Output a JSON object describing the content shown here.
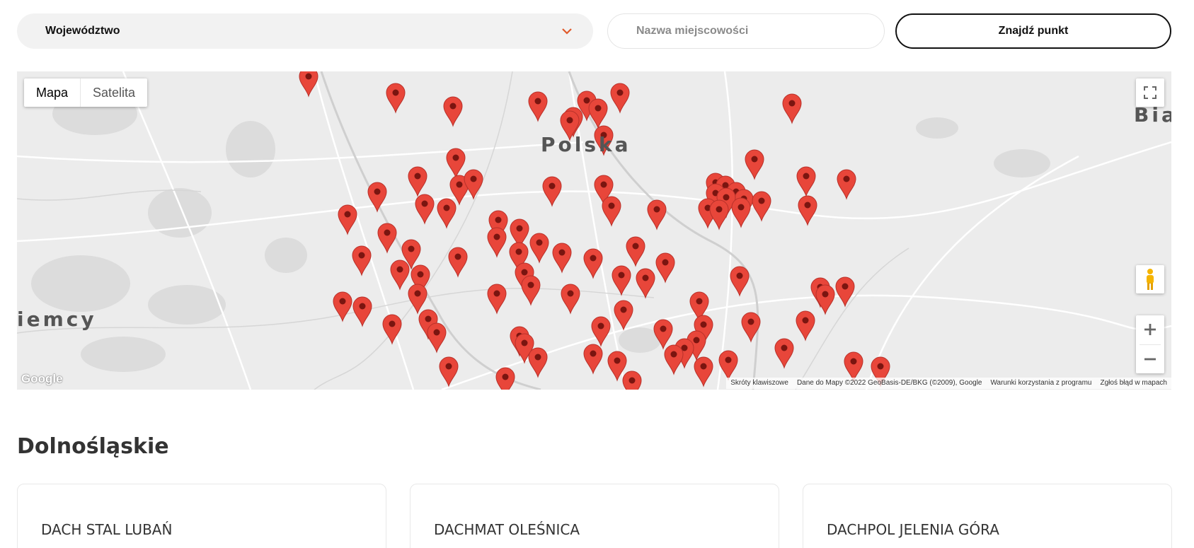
{
  "search": {
    "region_label": "Województwo",
    "city_placeholder": "Nazwa miejscowości",
    "find_button": "Znajdź punkt"
  },
  "map": {
    "type_buttons": [
      "Mapa",
      "Satelita"
    ],
    "labels": {
      "country_main": "Polska",
      "country_left": "iemcy",
      "city_right": "Bia"
    },
    "logo": "Google",
    "attribution": [
      "Skróty klawiszowe",
      "Dane do Mapy ©2022 GeoBasis-DE/BKG (©2009), Google",
      "Warunki korzystania z programu",
      "Zgłoś błąd w mapach"
    ],
    "marker_color": "#e8463a",
    "icons": [
      "fullscreen-icon",
      "pegman-icon",
      "zoom-in-icon",
      "zoom-out-icon",
      "chevron-down-icon",
      "map-marker-icon"
    ]
  },
  "section": {
    "title": "Dolnośląskie",
    "cards": [
      {
        "title": "DACH STAL LUBAŃ"
      },
      {
        "title": "DACHMAT OLEŚNICA"
      },
      {
        "title": "DACHPOL JELENIA GÓRA"
      }
    ]
  }
}
